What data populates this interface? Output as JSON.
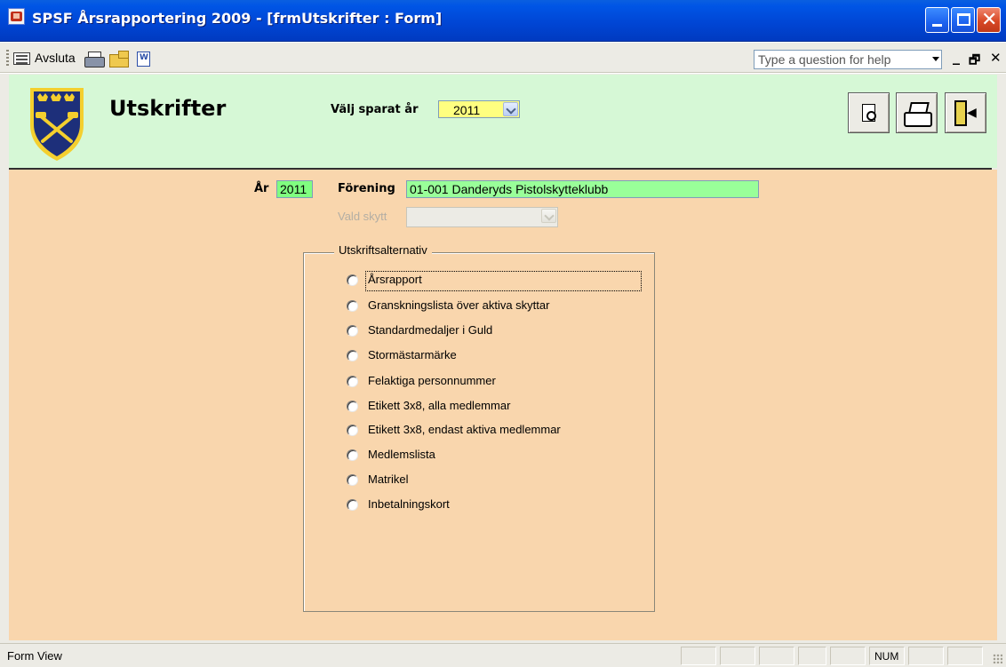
{
  "window": {
    "title": "SPSF Årsrapportering 2009 - [frmUtskrifter : Form]"
  },
  "toolbar": {
    "avsluta_label": "Avsluta",
    "help_placeholder": "Type a question for help"
  },
  "header": {
    "title": "Utskrifter",
    "year_select_label": "Välj sparat år",
    "year_select_value": "2011"
  },
  "detail": {
    "ar_label": "År",
    "ar_value": "2011",
    "forening_label": "Förening",
    "forening_value": "01-001 Danderyds Pistolskytteklubb",
    "vald_skytt_label": "Vald skytt",
    "group_title": "Utskriftsalternativ",
    "options": [
      "Årsrapport",
      "Granskningslista över aktiva skyttar",
      "Standardmedaljer i Guld",
      "Stormästarmärke",
      "Felaktiga personnummer",
      "Etikett 3x8, alla medlemmar",
      "Etikett 3x8, endast aktiva medlemmar",
      "Medlemslista",
      "Matrikel",
      "Inbetalningskort"
    ]
  },
  "statusbar": {
    "view": "Form View",
    "num": "NUM"
  },
  "colors": {
    "titlebar": "#0046d5",
    "header_bg": "#d6f8d6",
    "detail_bg": "#f9d6ad",
    "year_combo_bg": "#ffff80",
    "ar_field_bg": "#80ff80",
    "forening_field_bg": "#99ff99"
  }
}
